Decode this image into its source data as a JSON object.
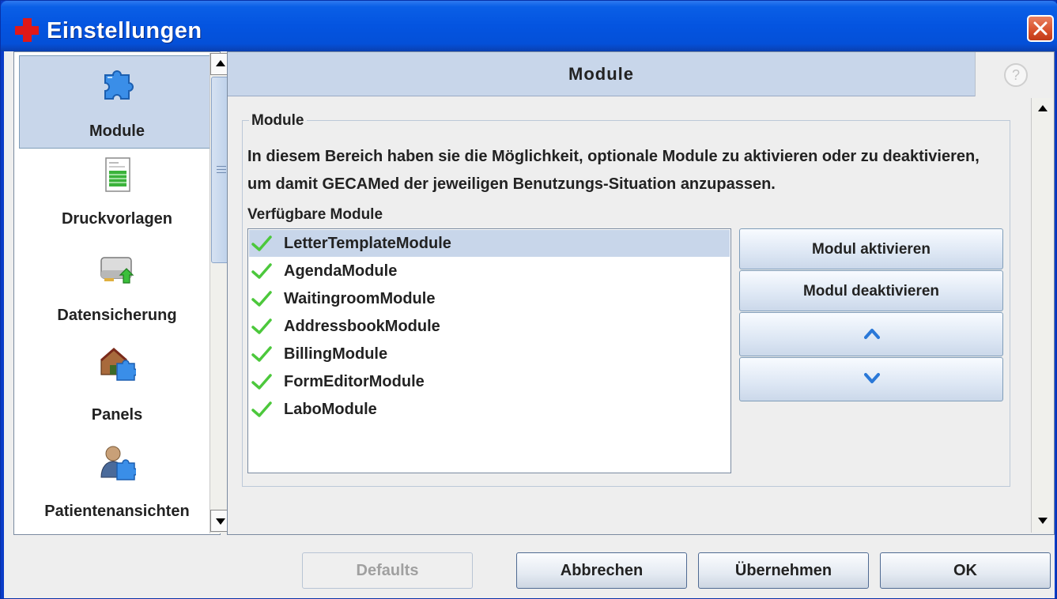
{
  "window": {
    "title": "Einstellungen",
    "title_icon": "red-cross-icon",
    "close_icon": "close-icon"
  },
  "sidebar": {
    "items": [
      {
        "label": "Module",
        "icon": "puzzle-icon",
        "selected": true
      },
      {
        "label": "Druckvorlagen",
        "icon": "document-icon",
        "selected": false
      },
      {
        "label": "Datensicherung",
        "icon": "drive-backup-icon",
        "selected": false
      },
      {
        "label": "Panels",
        "icon": "house-puzzle-icon",
        "selected": false
      },
      {
        "label": "Patientenansichten",
        "icon": "person-puzzle-icon",
        "selected": false
      }
    ]
  },
  "main": {
    "header_title": "Module",
    "help_icon": "help-icon",
    "help_glyph": "?",
    "group_title": "Module",
    "description": "In diesem Bereich haben sie die Möglichkeit, optionale Module zu aktivieren oder zu deaktivieren, um damit GECAMed der jeweiligen Benutzungs-Situation anzupassen.",
    "available_label": "Verfügbare Module",
    "modules": [
      {
        "name": "LetterTemplateModule",
        "active": true,
        "selected": true
      },
      {
        "name": "AgendaModule",
        "active": true,
        "selected": false
      },
      {
        "name": "WaitingroomModule",
        "active": true,
        "selected": false
      },
      {
        "name": "AddressbookModule",
        "active": true,
        "selected": false
      },
      {
        "name": "BillingModule",
        "active": true,
        "selected": false
      },
      {
        "name": "FormEditorModule",
        "active": true,
        "selected": false
      },
      {
        "name": "LaboModule",
        "active": true,
        "selected": false
      }
    ],
    "buttons": {
      "activate": "Modul aktivieren",
      "deactivate": "Modul deaktivieren",
      "move_up_icon": "chevron-up-icon",
      "move_down_icon": "chevron-down-icon"
    }
  },
  "footer": {
    "defaults": "Defaults",
    "cancel": "Abbrechen",
    "apply": "Übernehmen",
    "ok": "OK"
  },
  "colors": {
    "titlebar": "#0454e0",
    "selection": "#c8d6ea",
    "check": "#4cc83c"
  }
}
